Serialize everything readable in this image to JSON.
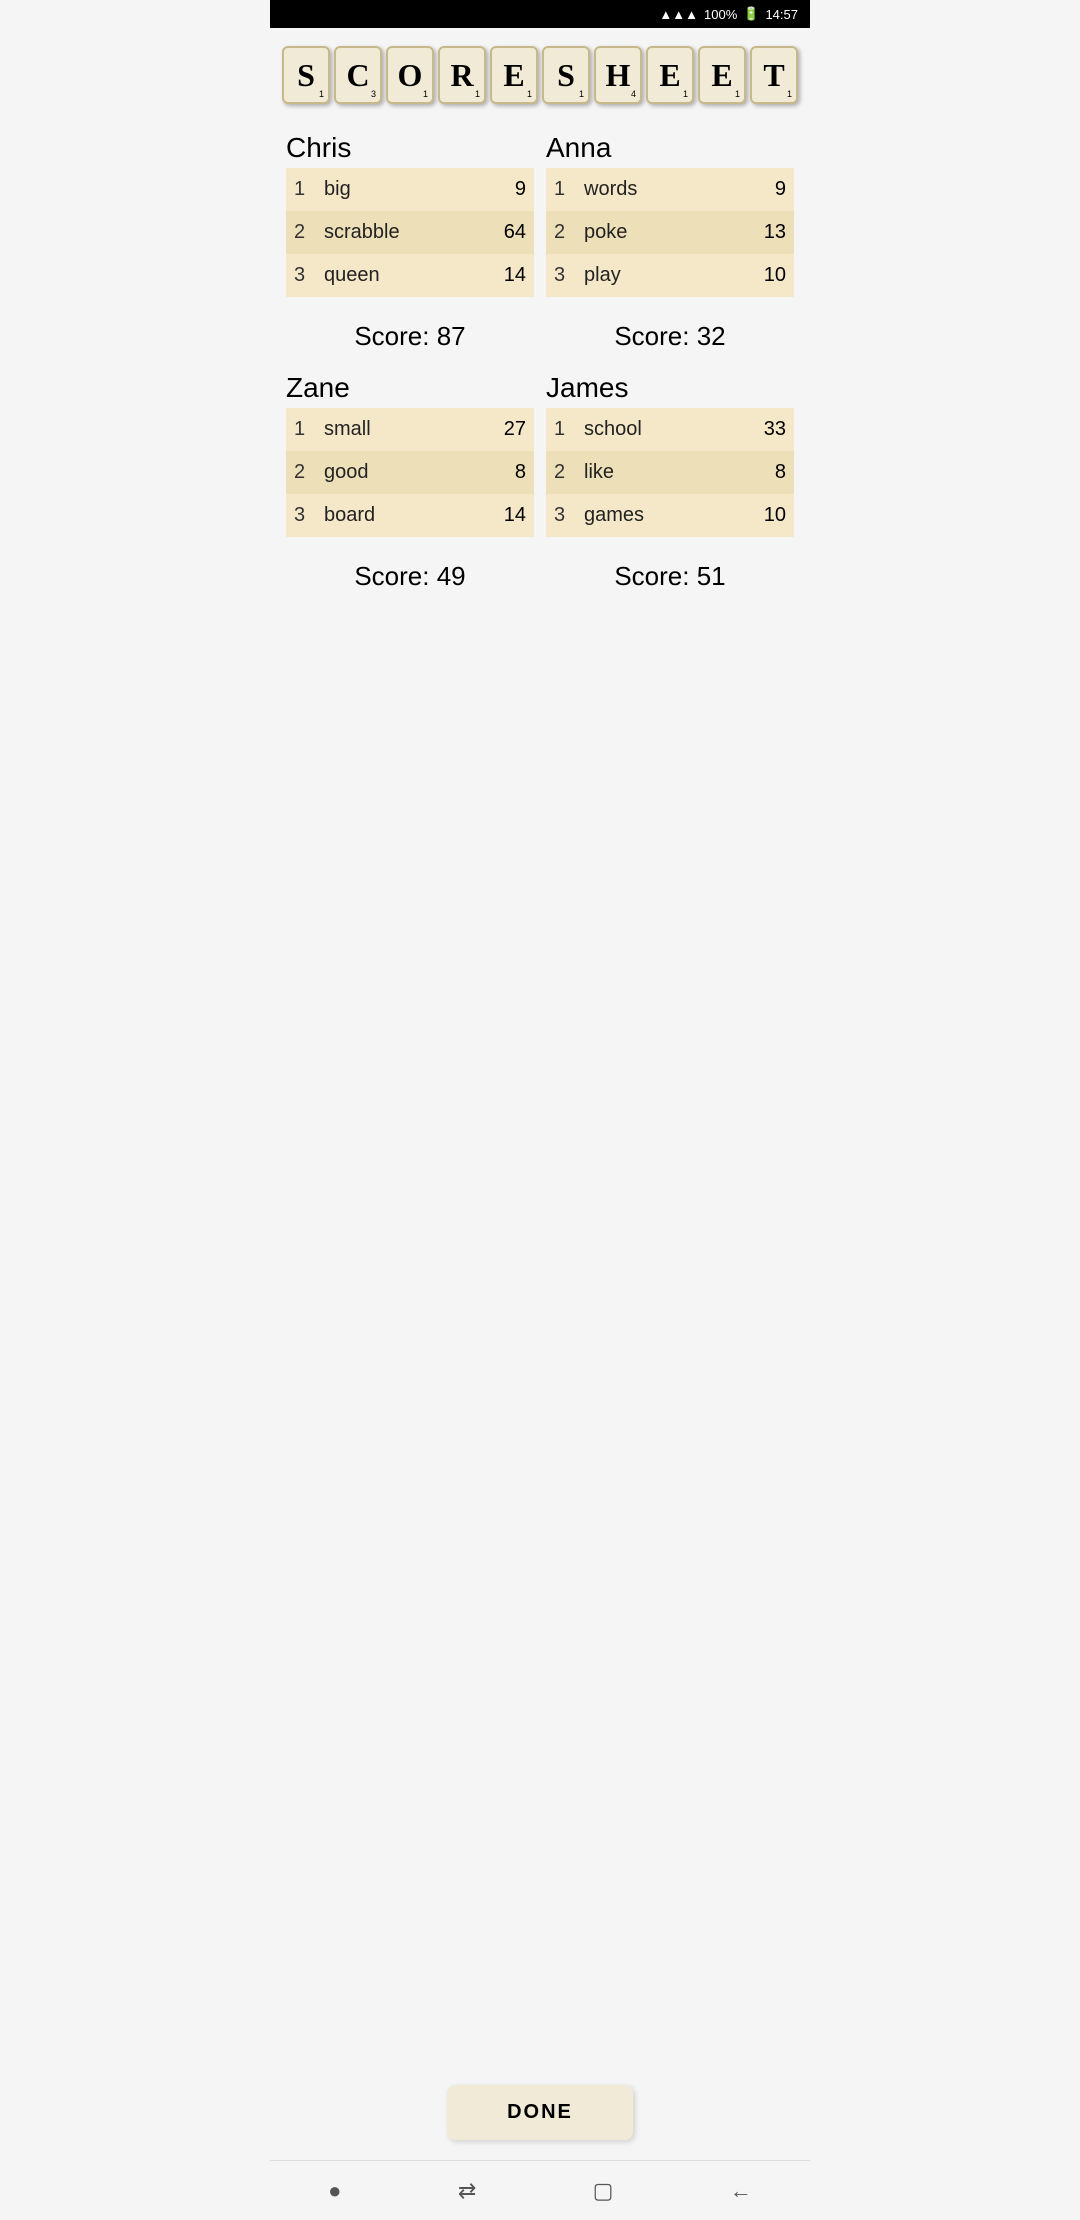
{
  "status_bar": {
    "signal": "▲▲▲▲",
    "battery": "100%",
    "time": "14:57"
  },
  "title": {
    "letters": [
      {
        "letter": "S",
        "number": "1"
      },
      {
        "letter": "C",
        "number": "3"
      },
      {
        "letter": "O",
        "number": "1"
      },
      {
        "letter": "R",
        "number": "1"
      },
      {
        "letter": "E",
        "number": "1"
      },
      {
        "letter": "S",
        "number": "1"
      },
      {
        "letter": "H",
        "number": "4"
      },
      {
        "letter": "E",
        "number": "1"
      },
      {
        "letter": "E",
        "number": "1"
      },
      {
        "letter": "T",
        "number": "1"
      }
    ]
  },
  "players": [
    {
      "name": "Chris",
      "entries": [
        {
          "turn": "1",
          "word": "big",
          "score": "9"
        },
        {
          "turn": "2",
          "word": "scrabble",
          "score": "64"
        },
        {
          "turn": "3",
          "word": "queen",
          "score": "14"
        }
      ],
      "total": "Score: 87"
    },
    {
      "name": "Anna",
      "entries": [
        {
          "turn": "1",
          "word": "words",
          "score": "9"
        },
        {
          "turn": "2",
          "word": "poke",
          "score": "13"
        },
        {
          "turn": "3",
          "word": "play",
          "score": "10"
        }
      ],
      "total": "Score: 32"
    },
    {
      "name": "Zane",
      "entries": [
        {
          "turn": "1",
          "word": "small",
          "score": "27"
        },
        {
          "turn": "2",
          "word": "good",
          "score": "8"
        },
        {
          "turn": "3",
          "word": "board",
          "score": "14"
        }
      ],
      "total": "Score: 49"
    },
    {
      "name": "James",
      "entries": [
        {
          "turn": "1",
          "word": "school",
          "score": "33"
        },
        {
          "turn": "2",
          "word": "like",
          "score": "8"
        },
        {
          "turn": "3",
          "word": "games",
          "score": "10"
        }
      ],
      "total": "Score: 51"
    }
  ],
  "done_button": "DONE",
  "nav": {
    "dot": "●",
    "arrows": "⇄",
    "square": "▢",
    "back": "←"
  }
}
